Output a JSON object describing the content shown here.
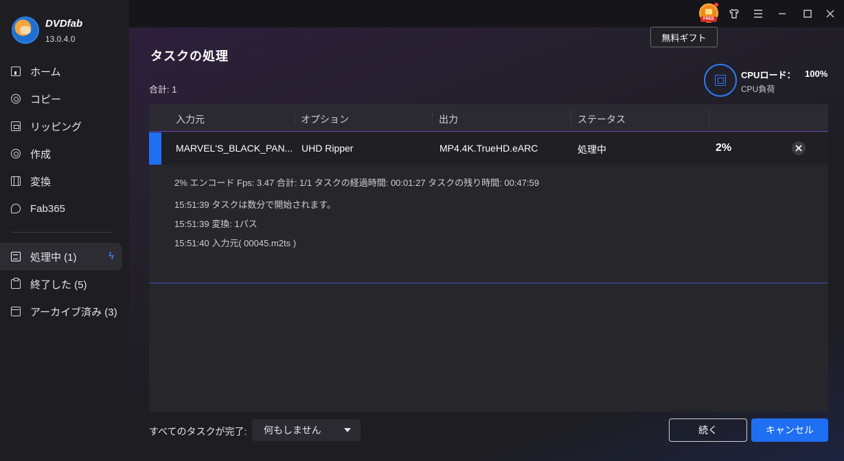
{
  "app": {
    "name": "DVDfab",
    "version": "13.0.4.0"
  },
  "sidebar": {
    "items": [
      {
        "label": "ホーム",
        "icon": "home-icon"
      },
      {
        "label": "コピー",
        "icon": "disc-icon"
      },
      {
        "label": "リッピング",
        "icon": "folder-icon"
      },
      {
        "label": "作成",
        "icon": "disc-icon"
      },
      {
        "label": "変換",
        "icon": "film-icon"
      },
      {
        "label": "Fab365",
        "icon": "fab365-icon"
      }
    ],
    "queue": [
      {
        "label": "処理中 (1)",
        "icon": "task-list-icon",
        "active": true
      },
      {
        "label": "終了した (5)",
        "icon": "clipboard-icon"
      },
      {
        "label": "アーカイブ済み (3)",
        "icon": "archive-icon"
      }
    ]
  },
  "titlebar": {
    "gift_badge": "FREE",
    "tooltip": "無料ギフト"
  },
  "page": {
    "title": "タスクの処理",
    "total": "合計: 1"
  },
  "cpu": {
    "label": "CPUロード：",
    "value": "100%",
    "sub": "CPU負荷",
    "accent": "#2f7cf6"
  },
  "table": {
    "headers": [
      "入力元",
      "オプション",
      "出力",
      "ステータス"
    ],
    "rows": [
      {
        "source": "MARVEL'S_BLACK_PAN...",
        "option": "UHD Ripper",
        "output": "MP4.4K.TrueHD.eARC",
        "status": "処理中",
        "progress": "2%"
      }
    ],
    "details": [
      "2%  エンコード Fps: 3.47   合計: 1/1  タスクの経過時間: 00:01:27  タスクの残り時間: 00:47:59",
      "15:51:39  タスクは数分で開始されます。",
      "15:51:39  変換: 1パス",
      "15:51:40  入力元( 00045.m2ts )"
    ]
  },
  "footer": {
    "label": "すべてのタスクが完了:",
    "select_value": "何もしません",
    "continue_label": "続く",
    "cancel_label": "キャンセル",
    "accent": "#1f6ff2"
  }
}
